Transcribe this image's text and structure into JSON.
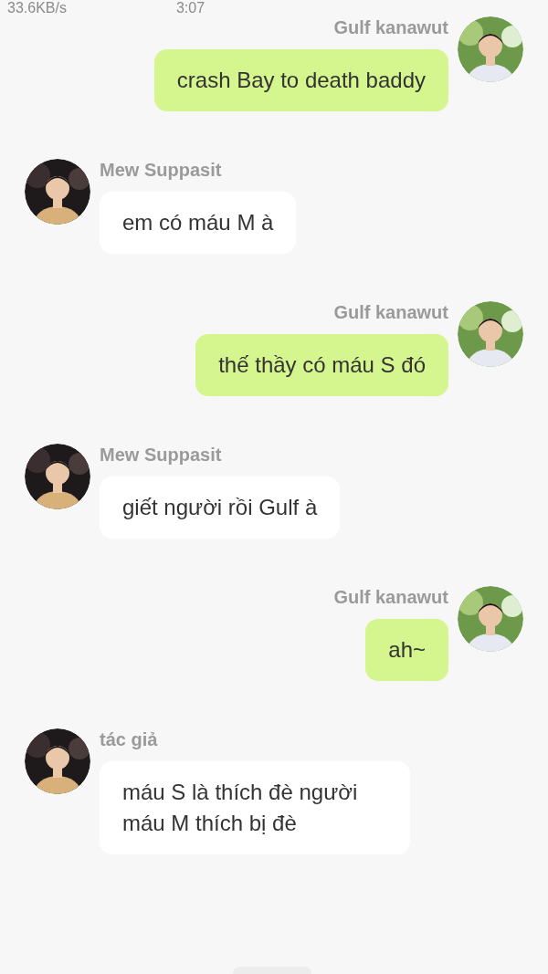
{
  "status_bar": {
    "speed": "33.6KB/s",
    "time": "3:07"
  },
  "messages": [
    {
      "kind": "sent",
      "sender": "Gulf kanawut",
      "text": "crash Bay to death baddy"
    },
    {
      "kind": "received",
      "sender": "Mew Suppasit",
      "text": "em có máu M à"
    },
    {
      "kind": "sent",
      "sender": "Gulf kanawut",
      "text": "thế thầy có máu S đó"
    },
    {
      "kind": "received",
      "sender": "Mew Suppasit",
      "text": "giết người rồi Gulf à"
    },
    {
      "kind": "sent",
      "sender": "Gulf kanawut",
      "text": "ah~"
    },
    {
      "kind": "received",
      "sender": "tác giả",
      "text": "máu S là thích đè người máu M thích bị đè"
    }
  ]
}
